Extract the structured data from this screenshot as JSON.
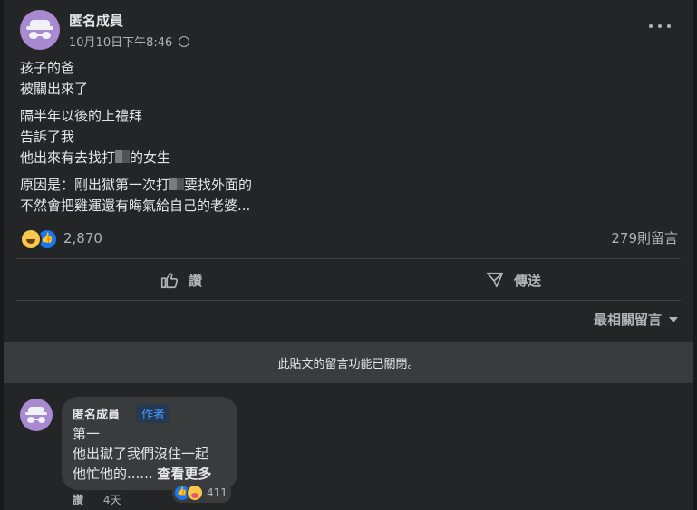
{
  "post": {
    "author": "匿名成員",
    "timestamp": "10月10日下午8:46",
    "privacy_icon": "globe-icon",
    "lines_block1": [
      "孩子的爸",
      "被關出來了"
    ],
    "lines_block2": [
      "隔半年以後的上禮拜",
      "告訴了我",
      "他出來有去找打",
      "的女生"
    ],
    "lines_block3": [
      "原因是：剛出獄第一次打",
      "要找外面的",
      "不然會把雞運還有晦氣給自己的老婆..."
    ],
    "reaction_count": "2,870",
    "comment_count": "279則留言",
    "like_label": "讚",
    "send_label": "傳送",
    "sort_label": "最相關留言",
    "comments_closed": "此貼文的留言功能已關閉。"
  },
  "comment": {
    "author": "匿名成員",
    "badge": "作者",
    "line1": "第一",
    "line2": "他出獄了我們沒住一起",
    "line3": "他忙他的......",
    "see_more": "查看更多",
    "like_label": "讚",
    "age": "4天",
    "reaction_count": "411"
  },
  "colors": {
    "background": "#18191a",
    "card": "#242526",
    "accent": "#1877f2",
    "secondary_text": "#b0b3b8"
  }
}
